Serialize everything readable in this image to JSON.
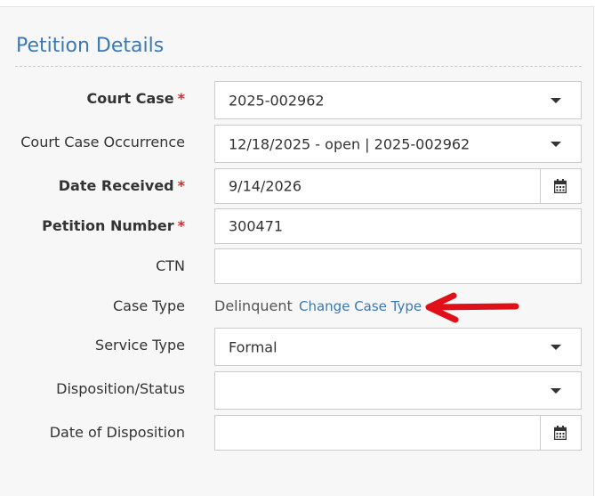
{
  "section": {
    "title": "Petition Details"
  },
  "fields": {
    "court_case": {
      "label": "Court Case",
      "required_mark": "*",
      "value": "2025-002962"
    },
    "occurrence": {
      "label": "Court Case Occurrence",
      "value": "12/18/2025 - open | 2025-002962"
    },
    "date_received": {
      "label": "Date Received",
      "required_mark": "*",
      "value": "9/14/2026"
    },
    "petition_number": {
      "label": "Petition Number",
      "required_mark": "*",
      "value": "300471"
    },
    "ctn": {
      "label": "CTN",
      "value": ""
    },
    "case_type": {
      "label": "Case Type",
      "value": "Delinquent",
      "link": "Change Case Type"
    },
    "service_type": {
      "label": "Service Type",
      "value": "Formal"
    },
    "disposition": {
      "label": "Disposition/Status",
      "value": ""
    },
    "date_of_disposition": {
      "label": "Date of Disposition",
      "value": ""
    }
  },
  "icons": {
    "calendar": "calendar-icon",
    "dropdown": "chevron-down-icon",
    "annotation": "red-arrow-icon"
  },
  "colors": {
    "accent": "#3a79b4",
    "required": "#c9302c",
    "annotation_arrow": "#e0101a"
  }
}
